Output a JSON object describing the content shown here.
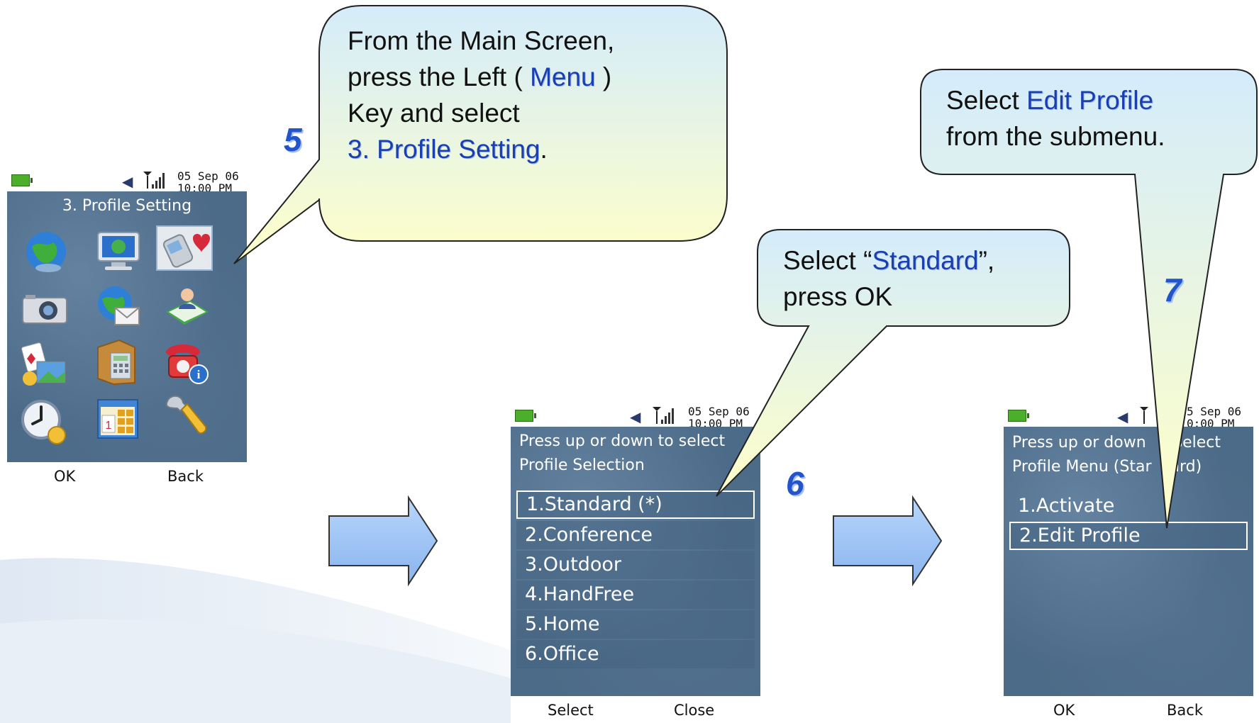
{
  "status": {
    "date": "05 Sep 06",
    "time": "10:00 PM",
    "date_partial": "5 Sep 06",
    "time_partial": "0:00 PM"
  },
  "phone_menu": {
    "title": "3. Profile Setting",
    "icons": [
      "globe-icon",
      "monitor-icon",
      "profile-setting-icon",
      "camera-icon",
      "web-mail-icon",
      "contacts-book-icon",
      "games-media-icon",
      "organizer-calculator-icon",
      "phone-info-icon",
      "alarm-clock-icon",
      "calendar-icon",
      "wrench-icon"
    ],
    "softkey_left": "OK",
    "softkey_right": "Back"
  },
  "phone_profiles": {
    "hint1": "Press up or down to select",
    "hint2": "Profile Selection",
    "items": [
      "1.Standard (*)",
      "2.Conference",
      "3.Outdoor",
      "4.HandFree",
      "5.Home",
      "6.Office"
    ],
    "selected_index": 0,
    "softkey_left": "Select",
    "softkey_right": "Close"
  },
  "phone_profile_menu": {
    "hint1_a": "Press up or down",
    "hint1_b": "select",
    "hint2_a": "Profile Menu (Star",
    "hint2_b": "ard)",
    "items": [
      "1.Activate",
      "2.Edit Profile"
    ],
    "selected_index": 1,
    "softkey_left": "OK",
    "softkey_right": "Back"
  },
  "callout5": {
    "step": "5",
    "line1": "From the Main Screen,",
    "line2a": "press the Left ( ",
    "line2b": "Menu",
    "line2c": " )",
    "line3": "Key and select",
    "line4a": " 3. Profile Setting",
    "line4b": "."
  },
  "callout6": {
    "step": "6",
    "line1a": "Select “",
    "line1b": "Standard",
    "line1c": "”,",
    "line2": "press OK"
  },
  "callout7": {
    "step": "7",
    "line1a": "Select ",
    "line1b": "Edit Profile",
    "line2": "from the submenu."
  },
  "colors": {
    "callout_fill_top": "#d4ecfb",
    "callout_fill_bottom": "#ffffc8",
    "arrow": "#9cc4f4",
    "keyword": "#1a3fb0",
    "step": "#2255cc"
  }
}
